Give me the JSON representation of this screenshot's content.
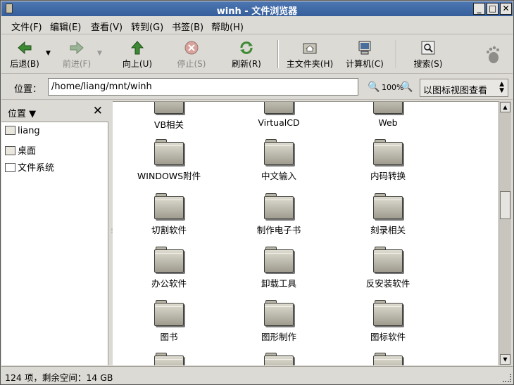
{
  "window": {
    "title": "winh - 文件浏览器"
  },
  "menu": [
    "文件(F)",
    "编辑(E)",
    "查看(V)",
    "转到(G)",
    "书签(B)",
    "帮助(H)"
  ],
  "toolbar": {
    "back": "后退(B)",
    "forward": "前进(F)",
    "up": "向上(U)",
    "stop": "停止(S)",
    "reload": "刷新(R)",
    "home": "主文件夹(H)",
    "computer": "计算机(C)",
    "search": "搜索(S)"
  },
  "location": {
    "label": "位置：",
    "path": "/home/liang/mnt/winh",
    "zoom": "100%",
    "view_mode": "以图标视图查看"
  },
  "sidebar": {
    "title": "位置",
    "items": [
      "liang",
      "桌面",
      "文件系统"
    ]
  },
  "files": [
    "VB相关",
    "VirtualCD",
    "Web",
    "WINDOWS附件",
    "中文输入",
    "内码转换",
    "切割软件",
    "制作电子书",
    "刻录相关",
    "办公软件",
    "卸载工具",
    "反安装软件",
    "图书",
    "图形制作",
    "图标软件",
    "",
    "",
    ""
  ],
  "status": "124 项，剩余空间：14 GB",
  "colors": {
    "titlebar": "#4172ad",
    "content_bg": "#ffffff"
  }
}
